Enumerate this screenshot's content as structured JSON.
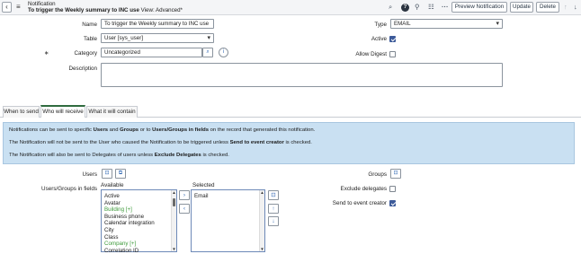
{
  "header": {
    "type_label": "Notification",
    "record_title": "To trigger the Weekly summary to INC use",
    "view_label": "View: Advanced*",
    "buttons": {
      "preview": "Preview Notification",
      "update": "Update",
      "delete": "Delete"
    }
  },
  "form": {
    "name": {
      "label": "Name",
      "value": "To trigger the Weekly summary to INC use"
    },
    "table": {
      "label": "Table",
      "value": "User [sys_user]"
    },
    "category": {
      "label": "Category",
      "value": "Uncategorized"
    },
    "description": {
      "label": "Description",
      "value": ""
    },
    "type": {
      "label": "Type",
      "value": "EMAIL"
    },
    "active": {
      "label": "Active",
      "checked": true
    },
    "allow_digest": {
      "label": "Allow Digest",
      "checked": false
    }
  },
  "tabs": [
    {
      "label": "When to send",
      "active": false
    },
    {
      "label": "Who will receive",
      "active": true
    },
    {
      "label": "What it will contain",
      "active": false
    }
  ],
  "info": {
    "line1": {
      "a": "Notifications can be sent to specific ",
      "b": "Users",
      "c": " and ",
      "d": "Groups",
      "e": " or to ",
      "f": "Users/Groups in fields",
      "g": " on the record that generated this notification."
    },
    "line2": {
      "a": "The Notification will not be sent to the User who caused the Notification to be triggered unless ",
      "b": "Send to event creator",
      "c": " is checked."
    },
    "line3": {
      "a": "The Notification will also be sent to Delegates of users unless ",
      "b": "Exclude Delegates",
      "c": " is checked."
    }
  },
  "recipients": {
    "users_label": "Users",
    "fields_label": "Users/Groups in fields",
    "available_label": "Available",
    "selected_label": "Selected",
    "available": [
      "Active",
      "Avatar",
      "Building [+]",
      "Business phone",
      "Calendar integration",
      "City",
      "Class",
      "Company [+]",
      "Correlation ID"
    ],
    "available_ref": [
      false,
      false,
      true,
      false,
      false,
      false,
      false,
      true,
      false
    ],
    "selected": [
      "Email"
    ],
    "groups_label": "Groups",
    "exclude_delegates": {
      "label": "Exclude delegates",
      "checked": false
    },
    "send_to_creator": {
      "label": "Send to event creator",
      "checked": true
    }
  }
}
